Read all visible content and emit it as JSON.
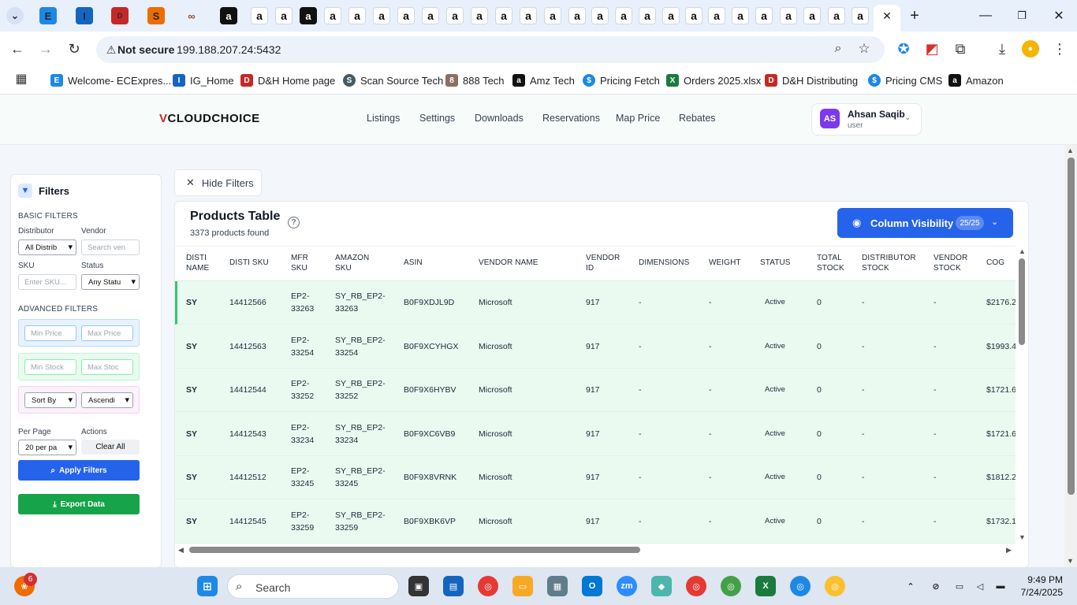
{
  "browser": {
    "not_secure": "Not secure",
    "url": "199.188.207.24:5432",
    "bookmarks": [
      {
        "label": "Welcome- ECExpres...",
        "color": "#1e88e5",
        "glyph": "EC"
      },
      {
        "label": "IG_Home",
        "color": "#1565c0",
        "glyph": "I"
      },
      {
        "label": "D&H Home page",
        "color": "#c62828",
        "glyph": "D"
      },
      {
        "label": "Scan Source Tech",
        "color": "#455a64",
        "glyph": "S"
      },
      {
        "label": "888 Tech",
        "color": "#8d6e63",
        "glyph": "8"
      },
      {
        "label": "Amz Tech",
        "color": "#111111",
        "glyph": "a"
      },
      {
        "label": "Pricing Fetch",
        "color": "#1e88e5",
        "glyph": "$"
      },
      {
        "label": "Orders 2025.xlsx",
        "color": "#1b7a3e",
        "glyph": "X"
      },
      {
        "label": "D&H Distributing",
        "color": "#c62828",
        "glyph": "D"
      },
      {
        "label": "Pricing CMS",
        "color": "#1e88e5",
        "glyph": "$"
      },
      {
        "label": "Amazon",
        "color": "#111111",
        "glyph": "a"
      }
    ]
  },
  "header": {
    "logo_v": "V",
    "logo_text": "CLOUDCHOICE",
    "nav": [
      "Listings",
      "Settings",
      "Downloads",
      "Reservations",
      "Map Price",
      "Rebates"
    ],
    "user": {
      "initials": "AS",
      "name": "Ahsan Saqib",
      "role": "user"
    }
  },
  "filters": {
    "title": "Filters",
    "basic_title": "BASIC FILTERS",
    "distributor_label": "Distributor",
    "distributor_value": "All Distrib",
    "vendor_label": "Vendor",
    "vendor_placeholder": "Search ven",
    "sku_label": "SKU",
    "sku_placeholder": "Enter SKU...",
    "status_label": "Status",
    "status_value": "Any Statu",
    "advanced_title": "ADVANCED FILTERS",
    "min_price": "Min Price",
    "max_price": "Max Price",
    "min_stock": "Min Stock",
    "max_stock": "Max Stoc",
    "sort_by": "Sort By",
    "sort_order": "Ascendi",
    "per_page_label": "Per Page",
    "per_page_value": "20 per pa",
    "actions_label": "Actions",
    "clear_all": "Clear All",
    "apply": "Apply Filters",
    "export": "Export Data"
  },
  "main": {
    "hide_filters": "Hide Filters",
    "table_title": "Products Table",
    "products_found": "3373 products found",
    "column_visibility": "Column Visibility",
    "column_count": "25/25",
    "columns": [
      [
        "DISTI",
        "NAME"
      ],
      [
        "DISTI SKU"
      ],
      [
        "MFR",
        "SKU"
      ],
      [
        "AMAZON",
        "SKU"
      ],
      [
        "ASIN"
      ],
      [
        "VENDOR NAME"
      ],
      [
        "VENDOR",
        "ID"
      ],
      [
        "DIMENSIONS"
      ],
      [
        "WEIGHT"
      ],
      [
        "STATUS"
      ],
      [
        "TOTAL",
        "STOCK"
      ],
      [
        "DISTRIBUTOR",
        "STOCK"
      ],
      [
        "VENDOR",
        "STOCK"
      ],
      [
        "COG"
      ]
    ],
    "rows": [
      {
        "disti": "SY",
        "sku": "14412566",
        "mfr1": "EP2-",
        "mfr2": "33263",
        "amz1": "SY_RB_EP2-",
        "amz2": "33263",
        "asin": "B0F9XDJL9D",
        "vendor": "Microsoft",
        "vid": "917",
        "dim": "-",
        "weight": "-",
        "status": "Active",
        "total": "0",
        "dstock": "-",
        "vstock": "-",
        "cog": "$2176.2"
      },
      {
        "disti": "SY",
        "sku": "14412563",
        "mfr1": "EP2-",
        "mfr2": "33254",
        "amz1": "SY_RB_EP2-",
        "amz2": "33254",
        "asin": "B0F9XCYHGX",
        "vendor": "Microsoft",
        "vid": "917",
        "dim": "-",
        "weight": "-",
        "status": "Active",
        "total": "0",
        "dstock": "-",
        "vstock": "-",
        "cog": "$1993.4"
      },
      {
        "disti": "SY",
        "sku": "14412544",
        "mfr1": "EP2-",
        "mfr2": "33252",
        "amz1": "SY_RB_EP2-",
        "amz2": "33252",
        "asin": "B0F9X6HYBV",
        "vendor": "Microsoft",
        "vid": "917",
        "dim": "-",
        "weight": "-",
        "status": "Active",
        "total": "0",
        "dstock": "-",
        "vstock": "-",
        "cog": "$1721.6"
      },
      {
        "disti": "SY",
        "sku": "14412543",
        "mfr1": "EP2-",
        "mfr2": "33234",
        "amz1": "SY_RB_EP2-",
        "amz2": "33234",
        "asin": "B0F9XC6VB9",
        "vendor": "Microsoft",
        "vid": "917",
        "dim": "-",
        "weight": "-",
        "status": "Active",
        "total": "0",
        "dstock": "-",
        "vstock": "-",
        "cog": "$1721.6"
      },
      {
        "disti": "SY",
        "sku": "14412512",
        "mfr1": "EP2-",
        "mfr2": "33245",
        "amz1": "SY_RB_EP2-",
        "amz2": "33245",
        "asin": "B0F9X8VRNK",
        "vendor": "Microsoft",
        "vid": "917",
        "dim": "-",
        "weight": "-",
        "status": "Active",
        "total": "0",
        "dstock": "-",
        "vstock": "-",
        "cog": "$1812.2"
      },
      {
        "disti": "SY",
        "sku": "14412545",
        "mfr1": "EP2-",
        "mfr2": "33259",
        "amz1": "SY_RB_EP2-",
        "amz2": "33259",
        "asin": "B0F9XBK6VP",
        "vendor": "Microsoft",
        "vid": "917",
        "dim": "-",
        "weight": "-",
        "status": "Active",
        "total": "0",
        "dstock": "-",
        "vstock": "-",
        "cog": "$1732.1"
      }
    ]
  },
  "taskbar": {
    "search": "Search",
    "notification_count": "6",
    "time": "9:49 PM",
    "date": "7/24/2025"
  }
}
